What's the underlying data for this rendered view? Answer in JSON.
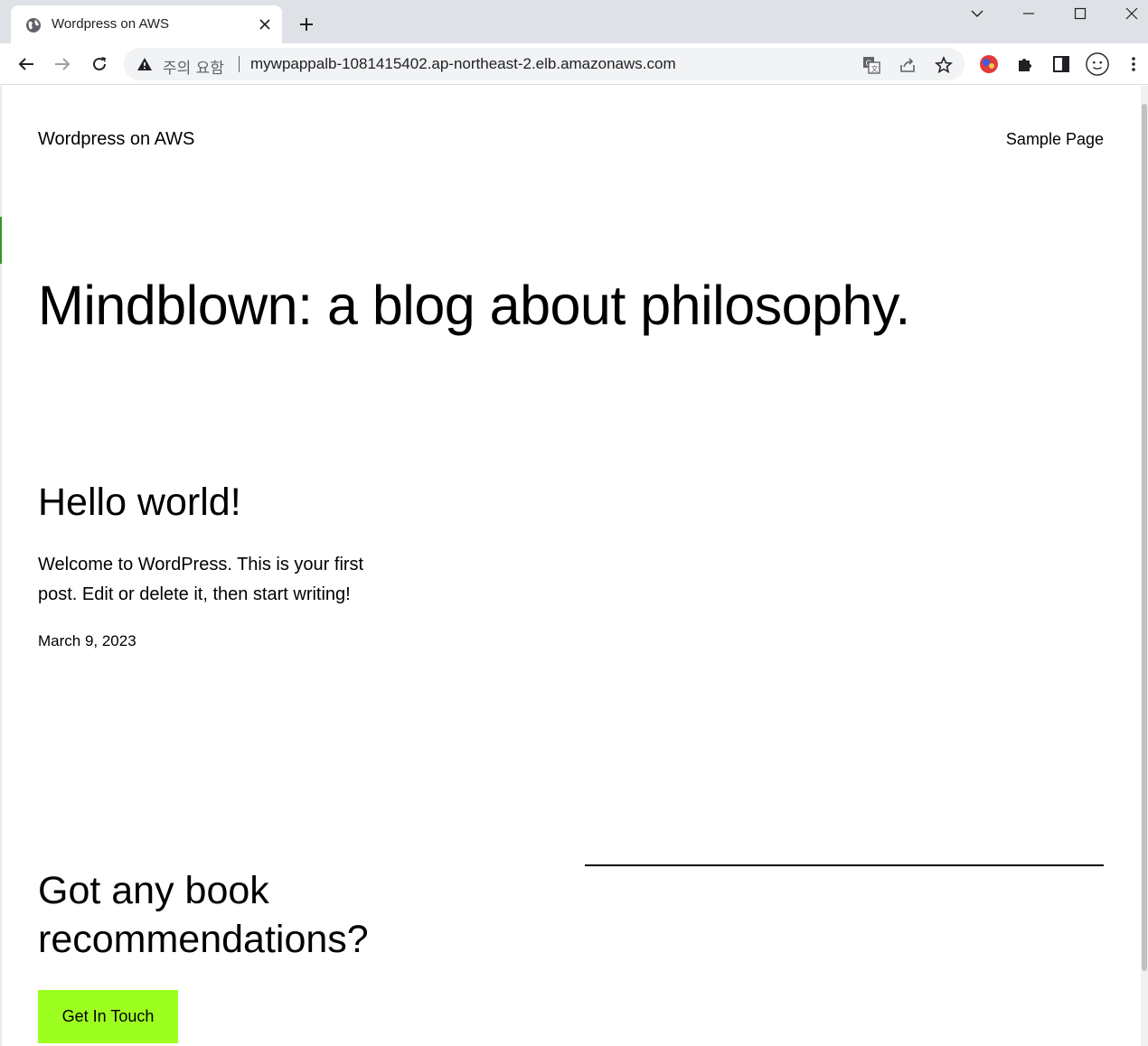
{
  "browser": {
    "tab": {
      "title": "Wordpress on AWS",
      "favicon": "globe-icon"
    },
    "omnibox": {
      "security_label": "주의 요함",
      "url": "mywpappalb-1081415402.ap-northeast-2.elb.amazonaws.com"
    },
    "icons": {
      "back": "arrow-left-icon",
      "forward": "arrow-right-icon",
      "reload": "reload-icon",
      "translate": "translate-icon",
      "share": "share-icon",
      "bookmark": "star-icon",
      "extensions": "puzzle-icon",
      "side_panel": "side-panel-icon",
      "profile": "profile-avatar-icon",
      "menu": "kebab-menu-icon"
    }
  },
  "site": {
    "title": "Wordpress on AWS",
    "nav": [
      "Sample Page"
    ]
  },
  "hero": {
    "title": "Mindblown: a blog about philosophy."
  },
  "post": {
    "title": "Hello world!",
    "excerpt": "Welcome to WordPress. This is your first post. Edit or delete it, then start writing!",
    "date": "March 9, 2023"
  },
  "cta": {
    "heading": "Got any book recommendations?",
    "button_label": "Get In Touch",
    "button_color": "#9dff20"
  }
}
